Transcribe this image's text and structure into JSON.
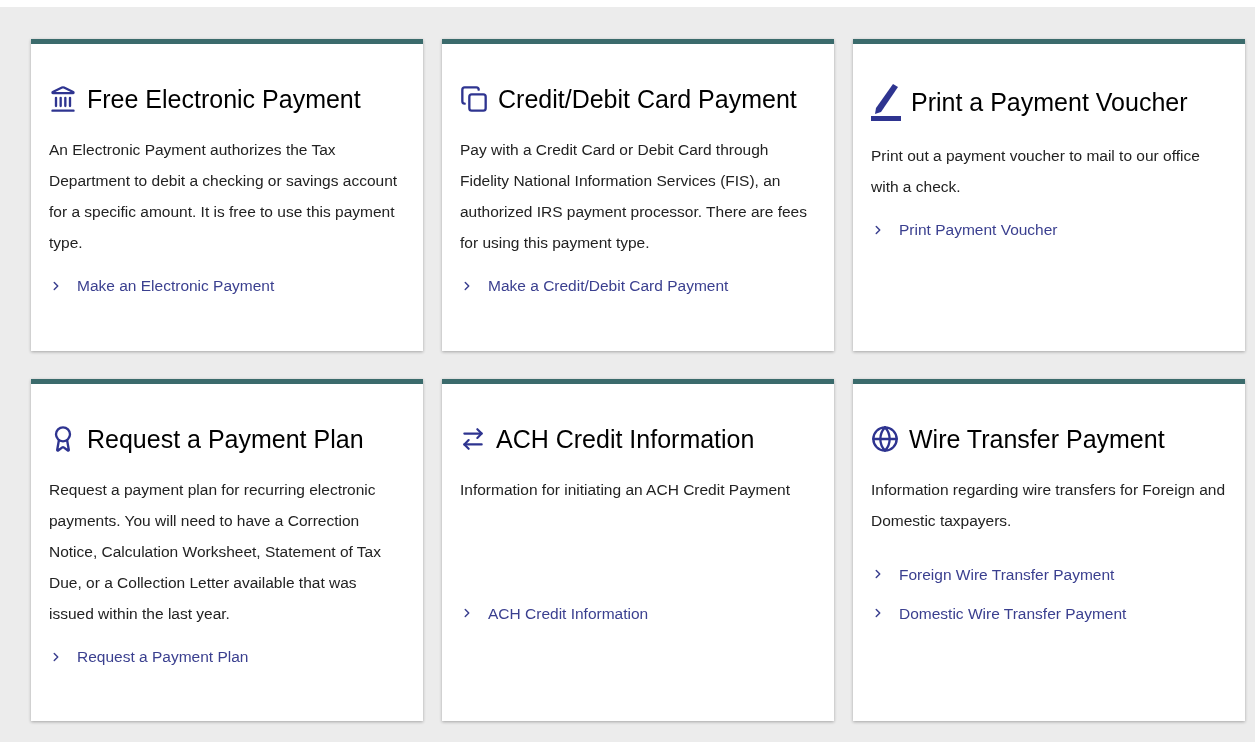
{
  "cards": [
    {
      "title": "Free Electronic Payment",
      "description": "An Electronic Payment authorizes the Tax Department to debit a checking or savings account for a specific amount. It is free to use this payment type.",
      "links": [
        "Make an Electronic Payment"
      ]
    },
    {
      "title": "Credit/Debit Card Payment",
      "description": "Pay with a Credit Card or Debit Card through Fidelity National Information Services (FIS), an authorized IRS payment processor. There are fees for using this payment type.",
      "links": [
        "Make a Credit/Debit Card Payment"
      ]
    },
    {
      "title": "Print a Payment Voucher",
      "description": "Print out a payment voucher to mail to our office with a check.",
      "links": [
        "Print Payment Voucher"
      ]
    },
    {
      "title": "Request a Payment Plan",
      "description": "Request a payment plan for recurring electronic payments. You will need to have a Correction Notice, Calculation Worksheet, Statement of Tax Due, or a Collection Letter available that was issued within the last year.",
      "links": [
        "Request a Payment Plan"
      ]
    },
    {
      "title": "ACH Credit Information",
      "description": "Information for initiating an ACH Credit Payment",
      "links": [
        "ACH Credit Information"
      ]
    },
    {
      "title": "Wire Transfer Payment",
      "description": "Information regarding wire transfers for Foreign and Domestic taxpayers.",
      "links": [
        "Foreign Wire Transfer Payment",
        "Domestic Wire Transfer Payment"
      ]
    }
  ]
}
